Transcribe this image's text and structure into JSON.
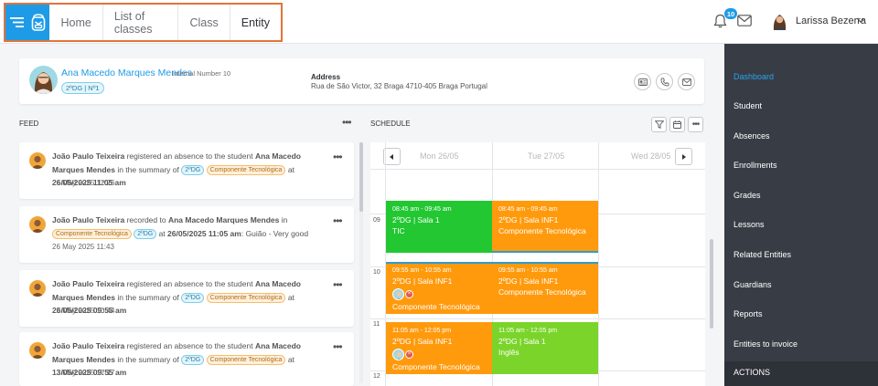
{
  "header": {
    "nav": [
      {
        "label": "Home"
      },
      {
        "label": "List of classes"
      },
      {
        "label": "Class"
      },
      {
        "label": "Entity"
      }
    ],
    "notifications_count": "10",
    "user_name": "Larissa Bezerra"
  },
  "student": {
    "name": "Ana Macedo Marques Mendes",
    "internal_number": "Internal Number 10",
    "class_tag": "2ºDG | Nº1",
    "address_label": "Address",
    "address_value": "Rua de São Victor, 32 Braga 4710-405 Braga Portugal"
  },
  "feed": {
    "title": "FEED",
    "items": [
      {
        "author": "João Paulo Teixeira",
        "action": " registered an absence to the student ",
        "student": "Ana Macedo Marques Mendes",
        "summary_prefix": " in the summary of ",
        "tag_class": "2ºDG",
        "tag_subject": "Componente Tecnológica",
        "at": " at ",
        "datetime": "26/05/2025 11:05 am",
        "date": "26 May 2025 12:26"
      },
      {
        "author": "João Paulo Teixeira",
        "action": " recorded to ",
        "student": "Ana Macedo Marques Mendes",
        "in": " in",
        "tag_subject": "Componente Tecnológica",
        "tag_class": "2ºDG",
        "at": " at ",
        "datetime": "26/05/2025 11:05 am",
        "suffix": ": Guião - Very good",
        "date": "26 May 2025 11:43"
      },
      {
        "author": "João Paulo Teixeira",
        "action": " registered an absence to the student ",
        "student": "Ana Macedo Marques Mendes",
        "summary_prefix": " in the summary of ",
        "tag_class": "2ºDG",
        "tag_subject": "Componente Tecnológica",
        "at": " at ",
        "datetime": "26/05/2025 09:55 am",
        "date": "23 May 2025 10:44"
      },
      {
        "author": "João Paulo Teixeira",
        "action": " registered an absence to the student ",
        "student": "Ana Macedo Marques Mendes",
        "summary_prefix": " in the summary of ",
        "tag_class": "2ºDG",
        "tag_subject": "Componente Tecnológica",
        "at": " at ",
        "datetime": "13/05/2025 09:55 am",
        "date": "13 May 2025 17:17"
      }
    ]
  },
  "schedule": {
    "title": "SCHEDULE",
    "days": [
      "Mon 26/05",
      "Tue 27/05",
      "Wed 28/05"
    ],
    "hours": [
      "09",
      "10",
      "11",
      "12"
    ],
    "events": [
      {
        "time": "08:45 am - 09:45 am",
        "room": "2ºDG | Sala 1",
        "subject": "TIC"
      },
      {
        "time": "08:45 am - 09:45 am",
        "room": "2ºDG | Sala INF1",
        "subject": "Componente Tecnológica"
      },
      {
        "time": "09:55 am - 10:55 am",
        "room": "2ºDG | Sala INF1",
        "subject": "Componente Tecnológica"
      },
      {
        "time": "09:55 am - 10:55 am",
        "room": "2ºDG | Sala INF1",
        "subject": "Componente Tecnológica"
      },
      {
        "time": "11:05 am - 12:05 pm",
        "room": "2ºDG | Sala INF1",
        "subject": "Componente Tecnológica"
      },
      {
        "time": "11:05 am - 12:05 pm",
        "room": "2ºDG | Sala 1",
        "subject": "Inglês"
      }
    ]
  },
  "sidebar": {
    "items": [
      {
        "label": "Dashboard"
      },
      {
        "label": "Student"
      },
      {
        "label": "Absences"
      },
      {
        "label": "Enrollments"
      },
      {
        "label": "Grades"
      },
      {
        "label": "Lessons"
      },
      {
        "label": "Related Entities"
      },
      {
        "label": "Guardians"
      },
      {
        "label": "Reports"
      },
      {
        "label": "Entities to invoice"
      }
    ],
    "actions_label": "ACTIONS"
  },
  "colors": {
    "primary": "#1d9be6",
    "highlight_frame": "#e2743a",
    "sidebar_bg": "#383d45",
    "event_green": "#22c732",
    "event_orange": "#ff9a0d",
    "event_lime": "#7bd42a"
  }
}
